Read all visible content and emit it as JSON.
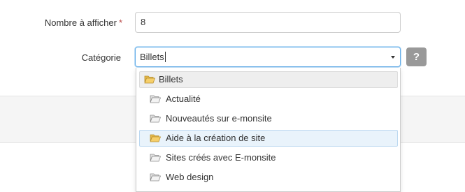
{
  "form": {
    "count_label": "Nombre à afficher",
    "required_mark": "*",
    "count_value": "8",
    "category_label": "Catégorie",
    "category_value": "Billets",
    "help_label": "?"
  },
  "dropdown": {
    "options": [
      {
        "label": "Billets",
        "icon": "folder-open-icon",
        "level": 0,
        "state": "selected"
      },
      {
        "label": "Actualité",
        "icon": "folder-icon",
        "level": 1,
        "state": "normal"
      },
      {
        "label": "Nouveautés sur e-monsite",
        "icon": "folder-icon",
        "level": 1,
        "state": "normal"
      },
      {
        "label": "Aide à la création de site",
        "icon": "folder-open-icon",
        "level": 1,
        "state": "highlighted"
      },
      {
        "label": "Sites créés avec E-monsite",
        "icon": "folder-icon",
        "level": 1,
        "state": "normal"
      },
      {
        "label": "Web design",
        "icon": "folder-icon",
        "level": 1,
        "state": "normal"
      }
    ]
  },
  "colors": {
    "focus_border": "#66afe9",
    "folder_yellow": "#f6cf6a",
    "folder_gray": "#bdbdbd",
    "help_button": "#999999",
    "required": "#b94a48"
  }
}
